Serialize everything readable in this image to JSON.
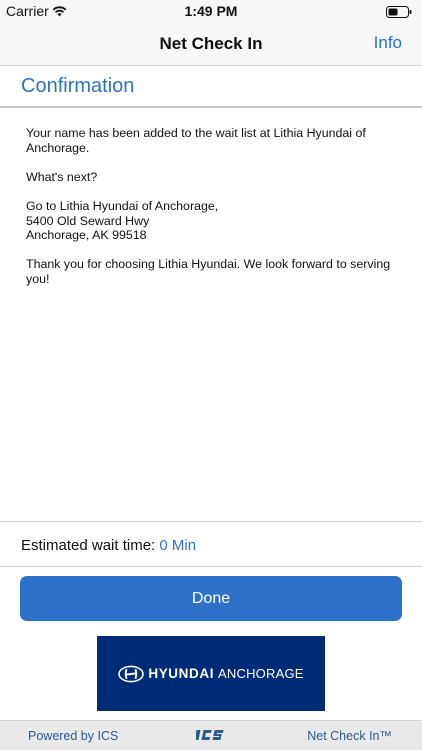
{
  "status_bar": {
    "carrier": "Carrier",
    "time": "1:49 PM"
  },
  "nav": {
    "title": "Net Check In",
    "info_label": "Info"
  },
  "section": {
    "title": "Confirmation"
  },
  "message": {
    "line1": "Your name has been added to the wait list at Lithia Hyundai of",
    "line2": "Anchorage.",
    "whats_next": "What's next?",
    "address1": "Go to Lithia Hyundai of Anchorage,",
    "address2": "5400 Old Seward Hwy",
    "address3": "Anchorage, AK 99518",
    "thanks1": "Thank you for choosing Lithia Hyundai. We look forward to serving",
    "thanks2": "you!"
  },
  "wait": {
    "label": "Estimated wait time:",
    "value": "0 Min"
  },
  "done_label": "Done",
  "logo": {
    "brand": "HYUNDAI",
    "location": "ANCHORAGE"
  },
  "footer": {
    "powered_by": "Powered by ICS",
    "product": "Net Check In™"
  },
  "colors": {
    "accent": "#2d72c8",
    "logo_bg": "#002c77",
    "footer_text": "#2f5a8c"
  },
  "icons": [
    "wifi-icon",
    "battery-icon",
    "hyundai-h-icon",
    "ics-logo-icon"
  ]
}
